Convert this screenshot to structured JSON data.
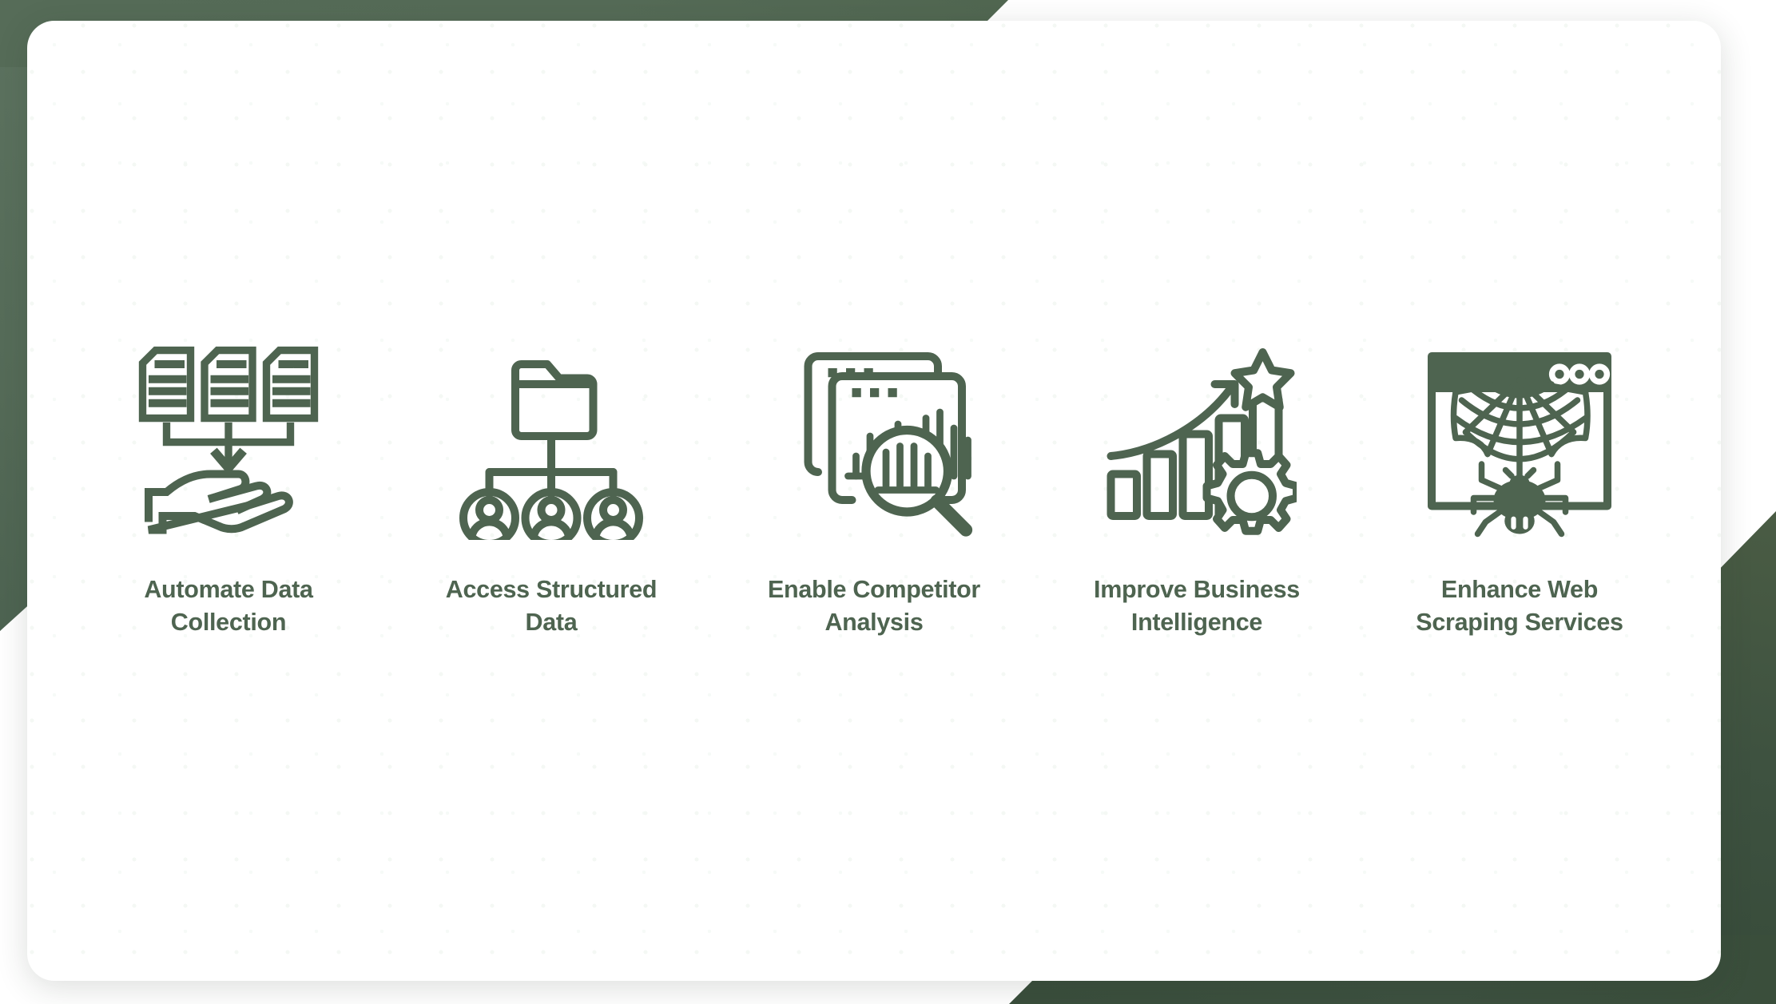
{
  "theme": {
    "accent_green": "#556b57",
    "accent_green_dark": "#3e5240",
    "icon_green": "#4e6450",
    "card_background": "#ffffff",
    "page_background": "#ffffff"
  },
  "card": {
    "features": [
      {
        "id": "automate-data-collection",
        "label": "Automate Data\nCollection",
        "icon": "documents-to-hand-icon",
        "icon_description": "Three documents with an arrow pointing down into an open hand"
      },
      {
        "id": "access-structured-data",
        "label": "Access Structured\nData",
        "icon": "folder-org-chart-icon",
        "icon_description": "Folder branching down to three user avatars"
      },
      {
        "id": "enable-competitor-analysis",
        "label": "Enable Competitor\nAnalysis",
        "icon": "browser-bar-chart-magnifier-icon",
        "icon_description": "Stacked browser windows with bar chart and magnifying glass"
      },
      {
        "id": "improve-business-intelligence",
        "label": "Improve Business\nIntelligence",
        "icon": "growth-chart-gear-star-icon",
        "icon_description": "Rising bar chart with upward arrow, star and gear"
      },
      {
        "id": "enhance-web-scraping-services",
        "label": "Enhance Web\nScraping Services",
        "icon": "browser-spider-web-icon",
        "icon_description": "Browser window with spider web and spider"
      }
    ]
  }
}
